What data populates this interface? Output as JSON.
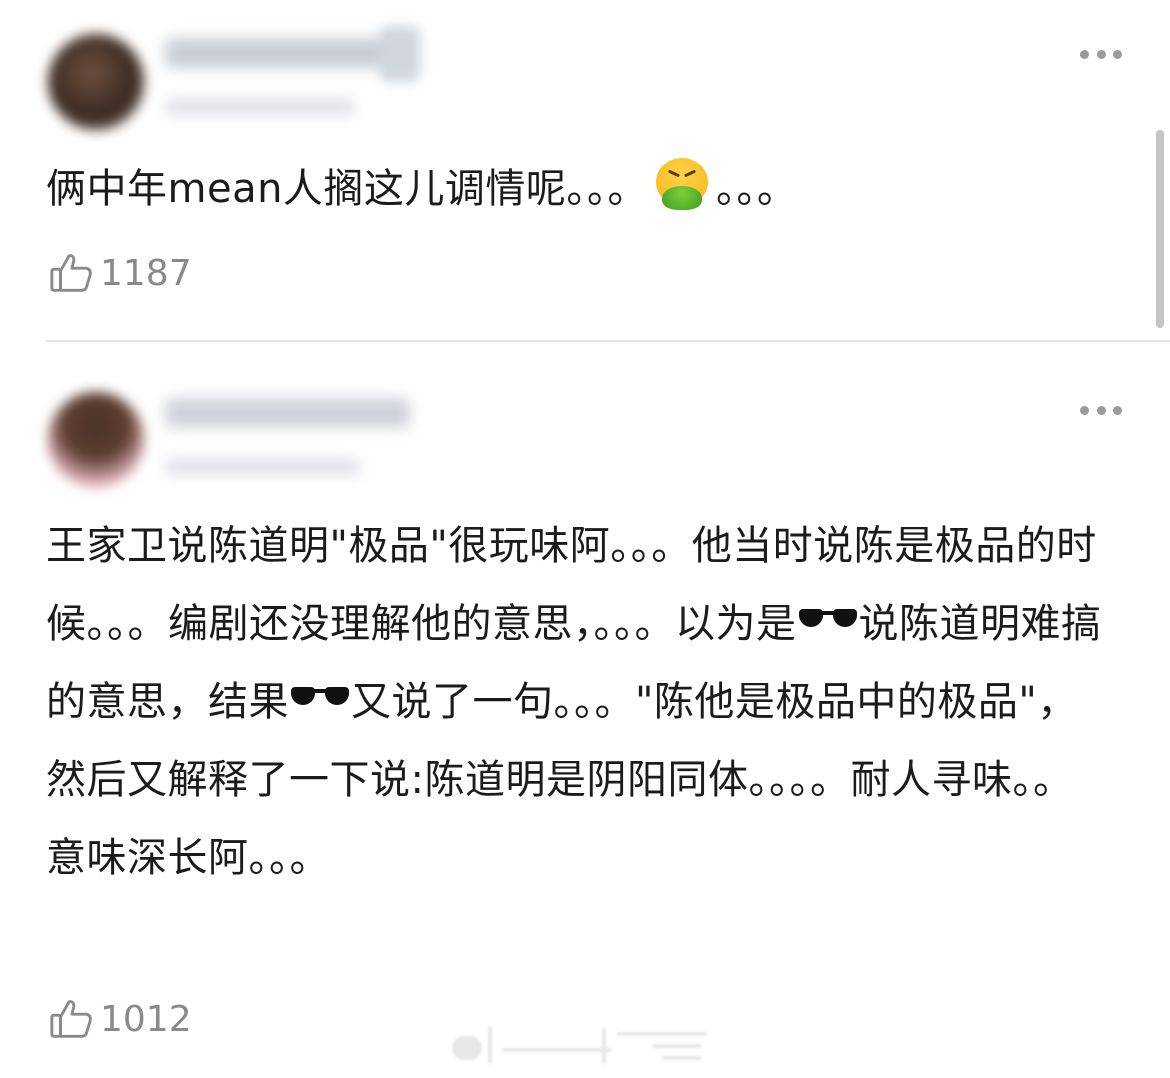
{
  "comments": [
    {
      "text_before": "俩中年mean人搁这儿调情呢。。。",
      "emoji": "face-vomiting",
      "text_after": "。。。",
      "likes": "1187"
    },
    {
      "text_parts": [
        "王家卫说陈道明\"极品\"很玩味阿。。。他当时说陈是极品的时候。。。编剧还没理解他的意思，。。。以为是",
        "说陈道明难搞的意思，结果",
        "又说了一句。。。\"陈他是极品中的极品\"，然后又解释了一下说:陈道明是阴阳同体。。。。耐人寻味。。意味深长阿。。。"
      ],
      "emoji": "sunglasses",
      "likes": "1012"
    }
  ],
  "icons": {
    "more": "more-dots-icon",
    "like": "thumbs-up-icon"
  },
  "colors": {
    "text": "#1b1b1b",
    "muted": "#8a8a8a",
    "divider": "#e4e4e4"
  }
}
